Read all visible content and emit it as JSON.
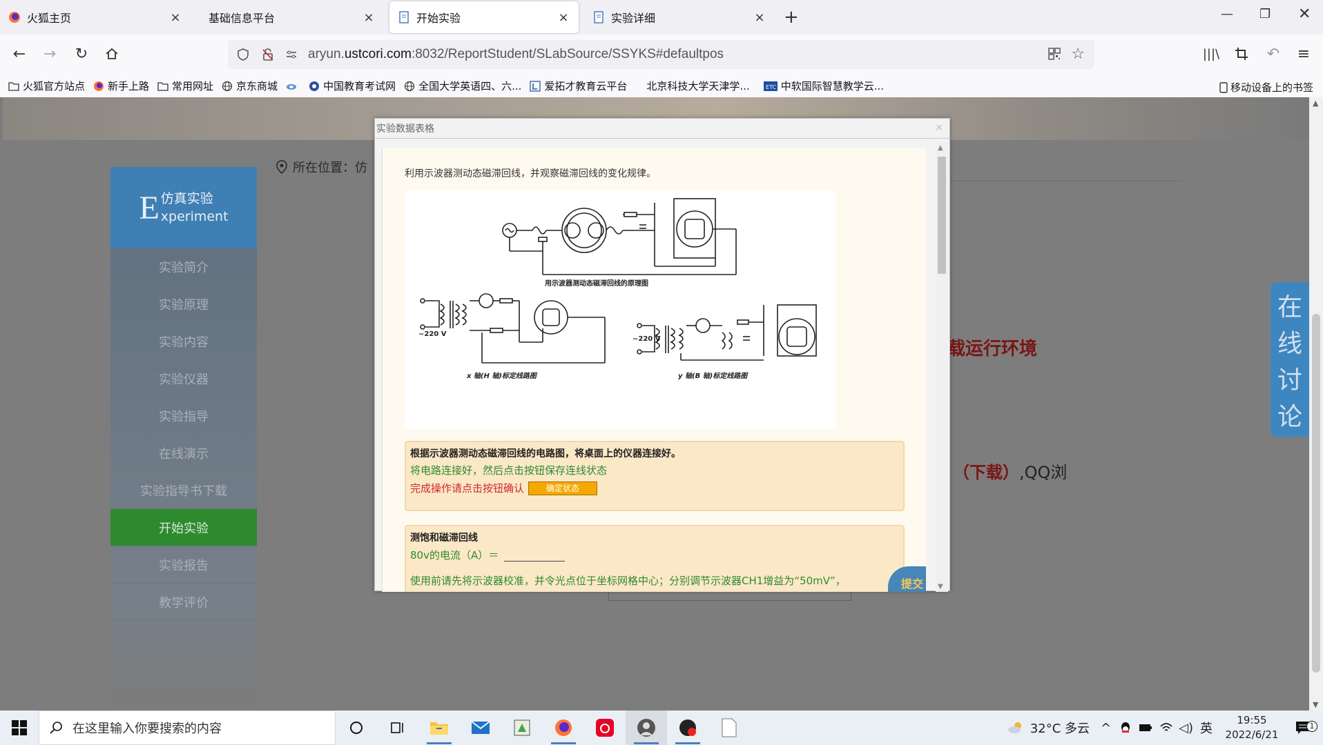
{
  "browser": {
    "tabs": [
      {
        "label": "火狐主页",
        "icon": "firefox-icon"
      },
      {
        "label": "基础信息平台",
        "icon": "blank-icon"
      },
      {
        "label": "开始实验",
        "icon": "page-icon"
      },
      {
        "label": "实验详细",
        "icon": "page-icon"
      }
    ],
    "url_prefix": "aryun.",
    "url_host": "ustcori.com",
    "url_path": ":8032/ReportStudent/SLabSource/SSYKS#defaultpos",
    "bookmarks": [
      {
        "label": "火狐官方站点",
        "icon": "folder-icon"
      },
      {
        "label": "新手上路",
        "icon": "firefox-icon"
      },
      {
        "label": "常用网址",
        "icon": "folder-icon"
      },
      {
        "label": "京东商城",
        "icon": "globe-icon"
      },
      {
        "label": "",
        "icon": "cloud-icon"
      },
      {
        "label": "中国教育考试网",
        "icon": "edu-icon"
      },
      {
        "label": "全国大学英语四、六...",
        "icon": "globe-icon"
      },
      {
        "label": "爱拓才教育云平台",
        "icon": "l-icon"
      },
      {
        "label": "北京科技大学天津学...",
        "icon": "blank-icon"
      },
      {
        "label": "中软国际智慧教学云...",
        "icon": "etc-icon"
      }
    ],
    "mobile_bookmarks": "移动设备上的书签"
  },
  "page": {
    "sidebar": {
      "logo_letter": "E",
      "logo_cn": "仿真实验",
      "logo_en": "xperiment",
      "items": [
        {
          "label": "实验简介",
          "active": false
        },
        {
          "label": "实验原理",
          "active": false
        },
        {
          "label": "实验内容",
          "active": false
        },
        {
          "label": "实验仪器",
          "active": false
        },
        {
          "label": "实验指导",
          "active": false
        },
        {
          "label": "在线演示",
          "active": false
        },
        {
          "label": "实验指导书下载",
          "active": false
        },
        {
          "label": "开始实验",
          "active": true
        },
        {
          "label": "实验报告",
          "active": false
        },
        {
          "label": "教学评价",
          "active": false
        }
      ]
    },
    "location_label": "所在位置：仿",
    "red_notice": "载运行环境",
    "red_notice2_red": "（下载）",
    "red_notice2_tail": ",QQ浏",
    "chat_tab": [
      "在",
      "线",
      "讨",
      "论"
    ]
  },
  "modal": {
    "title": "实验数据表格",
    "close": "×",
    "intro": "利用示波器测动态磁滞回线，并观察磁滞回线的变化规律。",
    "diagram_captions": {
      "top": "用示波器测动态磁滞回线的原理图",
      "left": "x 轴(H 轴)标定线路图",
      "right": "y 轴(B 轴)标定线路图",
      "voltage_left": "~220 V",
      "voltage_right": "~220 V"
    },
    "step": {
      "title": "根据示波器测动态磁滞回线的电路图，将桌面上的仪器连接好。",
      "green": "将电路连接好，然后点击按钮保存连线状态",
      "red": "完成操作请点击按钮确认",
      "confirm_label": "确定状态"
    },
    "measure": {
      "title": "测饱和磁滞回线",
      "field_label": "80v的电流（A）＝",
      "field_value": "",
      "note": "使用前请先将示波器校准，并令光点位于坐标网格中心；分别调节示波器CH1增益为“50mV”，"
    },
    "submit_label": "提交"
  },
  "taskbar": {
    "search_placeholder": "在这里输入你要搜索的内容",
    "weather": "32°C 多云",
    "ime": "英",
    "time": "19:55",
    "date": "2022/6/21",
    "notification_count": "1"
  }
}
